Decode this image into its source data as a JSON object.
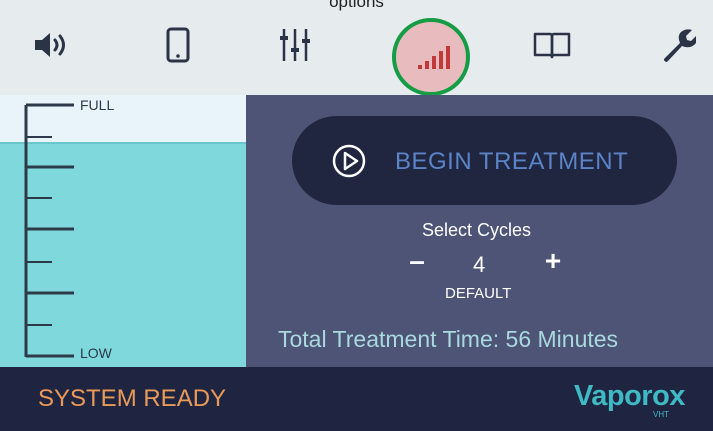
{
  "caption": "options",
  "toolbar": {
    "buttons": [
      {
        "icon": "speaker-icon",
        "active": false
      },
      {
        "icon": "phone-icon",
        "active": false
      },
      {
        "icon": "sliders-icon",
        "active": false
      },
      {
        "icon": "signal-bars-icon",
        "active": true
      },
      {
        "icon": "book-icon",
        "active": false
      },
      {
        "icon": "wrench-icon",
        "active": false
      }
    ],
    "active_color": "#e8bcbe",
    "highlight_ring_color": "#159c45",
    "icon_color": "#2b3347"
  },
  "tank": {
    "full_label": "FULL",
    "low_label": "LOW",
    "water_color": "#7fd8dc"
  },
  "treatment": {
    "begin_label": "BEGIN TREATMENT",
    "select_cycles_label": "Select Cycles",
    "minus_label": "–",
    "plus_label": "+",
    "cycles_value": "4",
    "default_label": "DEFAULT",
    "total_time_label": "Total Treatment Time: 56 Minutes"
  },
  "status": {
    "text": "SYSTEM READY",
    "text_color": "#e99a58"
  },
  "brand": {
    "name": "Vaporox",
    "subtitle": "VHT"
  }
}
